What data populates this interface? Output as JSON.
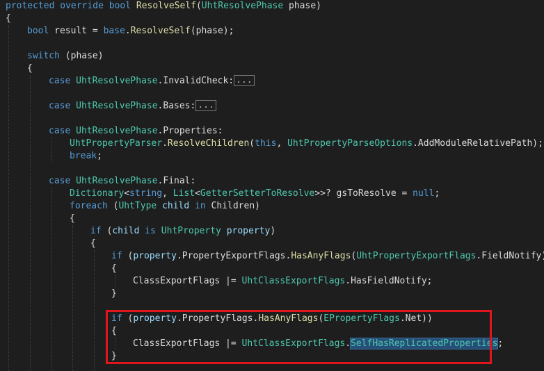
{
  "code_lines": [
    [
      {
        "c": "k",
        "t": "protected"
      },
      {
        "c": "p",
        "t": " "
      },
      {
        "c": "k",
        "t": "override"
      },
      {
        "c": "p",
        "t": " "
      },
      {
        "c": "k",
        "t": "bool"
      },
      {
        "c": "p",
        "t": " "
      },
      {
        "c": "m",
        "t": "ResolveSelf"
      },
      {
        "c": "p",
        "t": "("
      },
      {
        "c": "t",
        "t": "UhtResolvePhase"
      },
      {
        "c": "p",
        "t": " phase)"
      }
    ],
    [
      {
        "c": "p",
        "t": "{"
      }
    ],
    [
      {
        "c": "k",
        "t": "bool"
      },
      {
        "c": "p",
        "t": " result = "
      },
      {
        "c": "k",
        "t": "base"
      },
      {
        "c": "p",
        "t": "."
      },
      {
        "c": "m",
        "t": "ResolveSelf"
      },
      {
        "c": "p",
        "t": "(phase);"
      }
    ],
    [
      {
        "c": "k",
        "t": "switch"
      },
      {
        "c": "p",
        "t": " (phase)"
      }
    ],
    [
      {
        "c": "p",
        "t": "{"
      }
    ],
    [
      {
        "c": "k",
        "t": "case"
      },
      {
        "c": "p",
        "t": " "
      },
      {
        "c": "t",
        "t": "UhtResolvePhase"
      },
      {
        "c": "p",
        "t": ".InvalidCheck:"
      },
      {
        "c": "fold",
        "t": "..."
      }
    ],
    [
      {
        "c": "k",
        "t": "case"
      },
      {
        "c": "p",
        "t": " "
      },
      {
        "c": "t",
        "t": "UhtResolvePhase"
      },
      {
        "c": "p",
        "t": ".Bases:"
      },
      {
        "c": "fold",
        "t": "..."
      }
    ],
    [
      {
        "c": "k",
        "t": "case"
      },
      {
        "c": "p",
        "t": " "
      },
      {
        "c": "t",
        "t": "UhtResolvePhase"
      },
      {
        "c": "p",
        "t": ".Properties:"
      }
    ],
    [
      {
        "c": "t",
        "t": "UhtPropertyParser"
      },
      {
        "c": "p",
        "t": "."
      },
      {
        "c": "m",
        "t": "ResolveChildren"
      },
      {
        "c": "p",
        "t": "("
      },
      {
        "c": "k",
        "t": "this"
      },
      {
        "c": "p",
        "t": ", "
      },
      {
        "c": "t",
        "t": "UhtPropertyParseOptions"
      },
      {
        "c": "p",
        "t": ".AddModuleRelativePath);"
      }
    ],
    [
      {
        "c": "k",
        "t": "break"
      },
      {
        "c": "p",
        "t": ";"
      }
    ],
    [
      {
        "c": "k",
        "t": "case"
      },
      {
        "c": "p",
        "t": " "
      },
      {
        "c": "t",
        "t": "UhtResolvePhase"
      },
      {
        "c": "p",
        "t": ".Final:"
      }
    ],
    [
      {
        "c": "t",
        "t": "Dictionary"
      },
      {
        "c": "p",
        "t": "<"
      },
      {
        "c": "k",
        "t": "string"
      },
      {
        "c": "p",
        "t": ", "
      },
      {
        "c": "t",
        "t": "List"
      },
      {
        "c": "p",
        "t": "<"
      },
      {
        "c": "t",
        "t": "GetterSetterToResolve"
      },
      {
        "c": "p",
        "t": ">>? gsToResolve = "
      },
      {
        "c": "k",
        "t": "null"
      },
      {
        "c": "p",
        "t": ";"
      }
    ],
    [
      {
        "c": "k",
        "t": "foreach"
      },
      {
        "c": "p",
        "t": " ("
      },
      {
        "c": "t",
        "t": "UhtType"
      },
      {
        "c": "p",
        "t": " "
      },
      {
        "c": "v",
        "t": "child"
      },
      {
        "c": "p",
        "t": " "
      },
      {
        "c": "k",
        "t": "in"
      },
      {
        "c": "p",
        "t": " Children)"
      }
    ],
    [
      {
        "c": "p",
        "t": "{"
      }
    ],
    [
      {
        "c": "k",
        "t": "if"
      },
      {
        "c": "p",
        "t": " ("
      },
      {
        "c": "v",
        "t": "child"
      },
      {
        "c": "p",
        "t": " "
      },
      {
        "c": "k",
        "t": "is"
      },
      {
        "c": "p",
        "t": " "
      },
      {
        "c": "t",
        "t": "UhtProperty"
      },
      {
        "c": "p",
        "t": " "
      },
      {
        "c": "v",
        "t": "property"
      },
      {
        "c": "p",
        "t": ")"
      }
    ],
    [
      {
        "c": "p",
        "t": "{"
      }
    ],
    [
      {
        "c": "k",
        "t": "if"
      },
      {
        "c": "p",
        "t": " ("
      },
      {
        "c": "v",
        "t": "property"
      },
      {
        "c": "p",
        "t": ".PropertyExportFlags."
      },
      {
        "c": "m",
        "t": "HasAnyFlags"
      },
      {
        "c": "p",
        "t": "("
      },
      {
        "c": "t",
        "t": "UhtPropertyExportFlags"
      },
      {
        "c": "p",
        "t": ".FieldNotify))"
      }
    ],
    [
      {
        "c": "p",
        "t": "{"
      }
    ],
    [
      {
        "c": "p",
        "t": "ClassExportFlags |= "
      },
      {
        "c": "t",
        "t": "UhtClassExportFlags"
      },
      {
        "c": "p",
        "t": ".HasFieldNotify;"
      }
    ],
    [
      {
        "c": "p",
        "t": "}"
      }
    ],
    [
      {
        "c": "k",
        "t": "if"
      },
      {
        "c": "p",
        "t": " ("
      },
      {
        "c": "v",
        "t": "property"
      },
      {
        "c": "p",
        "t": ".PropertyFlags."
      },
      {
        "c": "m",
        "t": "HasAnyFlags"
      },
      {
        "c": "p",
        "t": "("
      },
      {
        "c": "t",
        "t": "EPropertyFlags"
      },
      {
        "c": "p",
        "t": ".Net))"
      }
    ],
    [
      {
        "c": "p",
        "t": "{"
      }
    ],
    [
      {
        "c": "p",
        "t": "ClassExportFlags |= "
      },
      {
        "c": "t",
        "t": "UhtClassExportFlags"
      },
      {
        "c": "p",
        "t": "."
      },
      {
        "c": "sel",
        "t": "SelfHasReplicatedProperties"
      },
      {
        "c": "p",
        "t": ";"
      }
    ],
    [
      {
        "c": "p",
        "t": "}"
      }
    ]
  ],
  "colors": {
    "background": "#1e1e1e",
    "keyword": "#569cd6",
    "type": "#4ec9b0",
    "method": "#dcdcaa",
    "variable": "#9cdcfe",
    "plain": "#dcdcdc",
    "selection": "#264f78",
    "highlight_border": "#e0151d"
  }
}
